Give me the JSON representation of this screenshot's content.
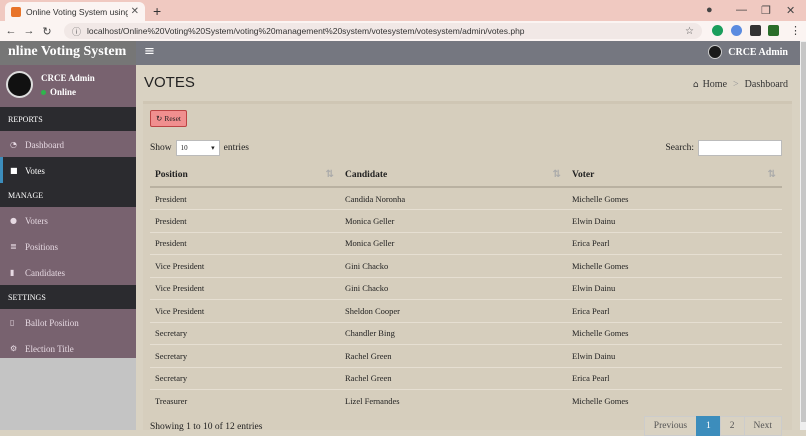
{
  "browser": {
    "tab_title": "Online Voting System using PHP",
    "url": "localhost/Online%20Voting%20System/voting%20management%20system/votesystem/votesystem/admin/votes.php"
  },
  "header": {
    "brand": "nline Voting System",
    "user": "CRCE Admin"
  },
  "sidebar": {
    "user_name": "CRCE Admin",
    "status": "Online",
    "sections": [
      {
        "title": "REPORTS",
        "items": [
          {
            "label": "Dashboard",
            "icon": "dashboard-icon"
          },
          {
            "label": "Votes",
            "icon": "lock-icon",
            "active": true
          }
        ]
      },
      {
        "title": "MANAGE",
        "items": [
          {
            "label": "Voters",
            "icon": "users-icon"
          },
          {
            "label": "Positions",
            "icon": "list-icon"
          },
          {
            "label": "Candidates",
            "icon": "user-card-icon"
          }
        ]
      },
      {
        "title": "SETTINGS",
        "items": [
          {
            "label": "Ballot Position",
            "icon": "file-icon"
          },
          {
            "label": "Election Title",
            "icon": "cog-icon"
          }
        ]
      }
    ]
  },
  "page": {
    "title": "VOTES",
    "breadcrumb": {
      "home": "Home",
      "current": "Dashboard"
    },
    "reset_label": "Reset",
    "show_label": "Show",
    "entries_value": "10",
    "entries_label": "entries",
    "search_label": "Search:",
    "columns": [
      "Position",
      "Candidate",
      "Voter"
    ],
    "rows": [
      [
        "President",
        "Candida Noronha",
        "Michelle Gomes"
      ],
      [
        "President",
        "Monica Geller",
        "Elwin Dainu"
      ],
      [
        "President",
        "Monica Geller",
        "Erica Pearl"
      ],
      [
        "Vice President",
        "Gini Chacko",
        "Michelle Gomes"
      ],
      [
        "Vice President",
        "Gini Chacko",
        "Elwin Dainu"
      ],
      [
        "Vice President",
        "Sheldon Cooper",
        "Erica Pearl"
      ],
      [
        "Secretary",
        "Chandler Bing",
        "Michelle Gomes"
      ],
      [
        "Secretary",
        "Rachel Green",
        "Elwin Dainu"
      ],
      [
        "Secretary",
        "Rachel Green",
        "Erica Pearl"
      ],
      [
        "Treasurer",
        "Lizel Fernandes",
        "Michelle Gomes"
      ]
    ],
    "info": "Showing 1 to 10 of 12 entries",
    "pager": {
      "previous": "Previous",
      "pages": [
        "1",
        "2"
      ],
      "next": "Next"
    }
  },
  "colors": {
    "accent": "#3c8dbc",
    "reset": "#f08f8f",
    "sidebar": "#78626f"
  }
}
